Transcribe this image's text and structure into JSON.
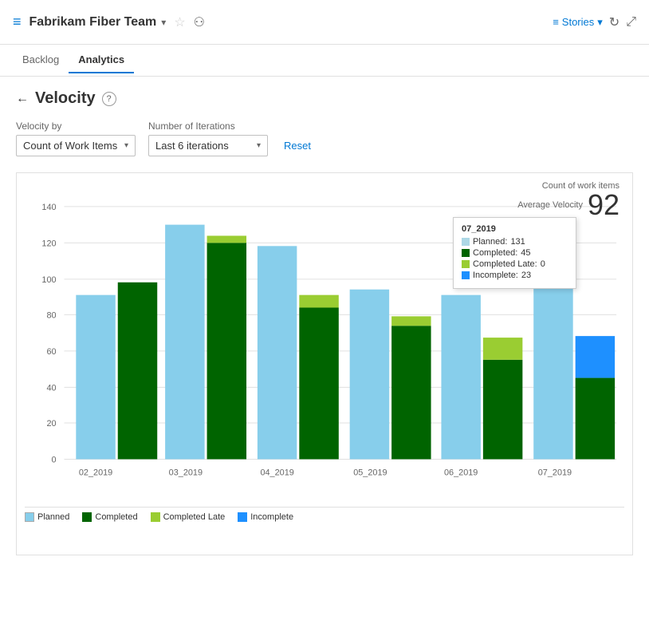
{
  "header": {
    "icon": "≡",
    "title": "Fabrikam Fiber Team",
    "stories_label": "Stories",
    "refresh_label": "↻",
    "expand_label": "⤢"
  },
  "nav": {
    "tabs": [
      {
        "label": "Backlog",
        "active": false
      },
      {
        "label": "Analytics",
        "active": true
      }
    ]
  },
  "page": {
    "title": "Velocity",
    "back_label": "←",
    "help_label": "?"
  },
  "filters": {
    "velocity_by_label": "Velocity by",
    "velocity_by_value": "Count of Work Items",
    "iterations_label": "Number of Iterations",
    "iterations_value": "Last 6 iterations",
    "reset_label": "Reset"
  },
  "summary": {
    "count_label": "Count of work items",
    "avg_label": "Average Velocity",
    "value": "92"
  },
  "tooltip": {
    "title": "07_2019",
    "planned_label": "Planned:",
    "planned_value": "131",
    "completed_label": "Completed:",
    "completed_value": "45",
    "completed_late_label": "Completed Late:",
    "completed_late_value": "0",
    "incomplete_label": "Incomplete:",
    "incomplete_value": "23"
  },
  "chart": {
    "y_labels": [
      "0",
      "20",
      "40",
      "60",
      "80",
      "100",
      "120",
      "140"
    ],
    "bars": [
      {
        "label": "02_2019",
        "planned": 91,
        "completed": 98,
        "completed_late": 0,
        "incomplete": 0
      },
      {
        "label": "03_2019",
        "planned": 130,
        "completed": 120,
        "completed_late": 0,
        "incomplete": 0
      },
      {
        "label": "04_2019",
        "planned": 118,
        "completed": 84,
        "completed_late": 7,
        "incomplete": 0
      },
      {
        "label": "05_2019",
        "planned": 94,
        "completed": 74,
        "completed_late": 5,
        "incomplete": 0
      },
      {
        "label": "06_2019",
        "planned": 91,
        "completed": 55,
        "completed_late": 12,
        "incomplete": 0
      },
      {
        "label": "07_2019",
        "planned": 131,
        "completed": 45,
        "completed_late": 0,
        "incomplete": 23
      }
    ]
  },
  "legend": {
    "items": [
      {
        "label": "Planned",
        "color": "#add8e6"
      },
      {
        "label": "Completed",
        "color": "#006400"
      },
      {
        "label": "Completed Late",
        "color": "#9acd32"
      },
      {
        "label": "Incomplete",
        "color": "#1e90ff"
      }
    ]
  },
  "colors": {
    "planned": "#87ceeb",
    "completed": "#006400",
    "completed_late": "#9acd32",
    "incomplete": "#1e90ff",
    "accent": "#0078d4"
  }
}
